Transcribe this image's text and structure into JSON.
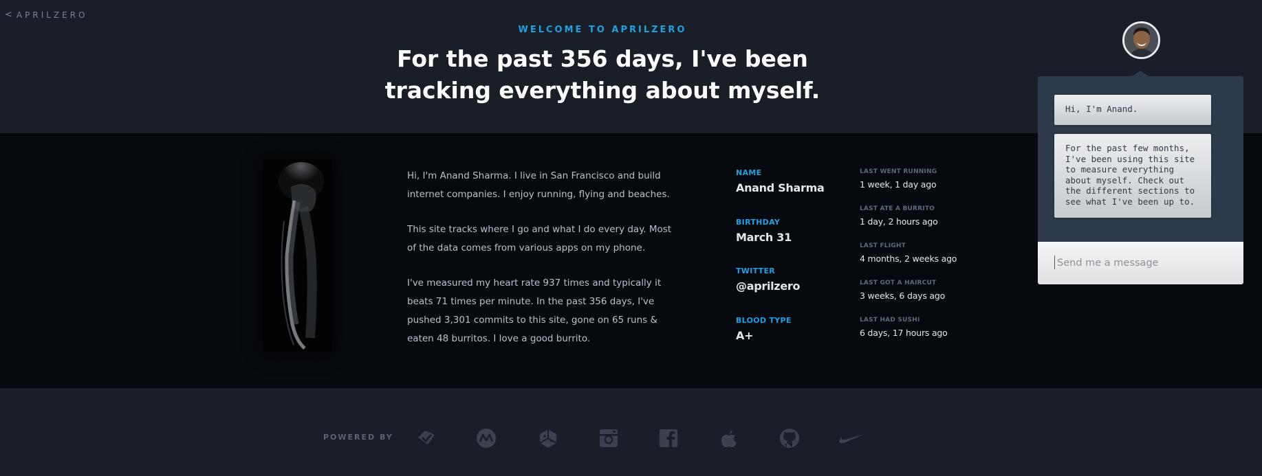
{
  "header": {
    "back_link": "APRILZERO",
    "kicker": "WELCOME TO APRILZERO",
    "headline_line1": "For the past 356 days, I've been",
    "headline_line2": "tracking everything about myself."
  },
  "bio": {
    "p1": "Hi, I'm Anand Sharma. I live in San Francisco and build internet companies. I enjoy running, flying and beaches.",
    "p2": "This site tracks where I go and what I do every day. Most of the data comes from various apps on my phone.",
    "p3": "I've measured my heart rate 937 times and typically it beats 71 times per minute. In the past 356 days, I've pushed 3,301 commits to this site, gone on 65 runs & eaten 48 burritos. I love a good burrito."
  },
  "facts": [
    {
      "label": "NAME",
      "value": "Anand Sharma"
    },
    {
      "label": "BIRTHDAY",
      "value": "March 31"
    },
    {
      "label": "TWITTER",
      "value": "@aprilzero"
    },
    {
      "label": "BLOOD TYPE",
      "value": "A+"
    }
  ],
  "stats": [
    {
      "label": "LAST WENT RUNNING",
      "value": "1 week, 1 day ago"
    },
    {
      "label": "LAST ATE A BURRITO",
      "value": "1 day, 2 hours ago"
    },
    {
      "label": "LAST FLIGHT",
      "value": "4 months, 2 weeks ago"
    },
    {
      "label": "LAST GOT A HAIRCUT",
      "value": "3 weeks, 6 days ago"
    },
    {
      "label": "LAST HAD SUSHI",
      "value": "6 days, 17 hours ago"
    }
  ],
  "footer": {
    "powered_by": "POWERED BY",
    "brands": [
      "foursquare-icon",
      "moves-icon",
      "openpaths-icon",
      "instagram-icon",
      "facebook-icon",
      "apple-icon",
      "github-icon",
      "nike-icon"
    ]
  },
  "chat": {
    "message1": "Hi, I'm Anand.",
    "message2": "For the past few months, I've been using this site to measure everything about myself. Check out the different sections to see what I've been up to.",
    "input_placeholder": "Send me a message"
  },
  "colors": {
    "background": "#191e27",
    "band": "#06090d",
    "accent": "#1ea1e3",
    "chat_panel": "#2d3a4b"
  }
}
